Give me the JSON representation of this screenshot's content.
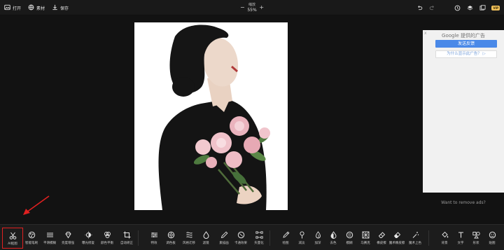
{
  "topbar": {
    "open_label": "打开",
    "assets_label": "素材",
    "save_label": "保存",
    "zoom_label": "缩放",
    "zoom_value": "55%",
    "zoom_minus": "−",
    "zoom_plus": "+",
    "vip_badge": "VIP"
  },
  "ad": {
    "close_symbol": "x",
    "google_text": "Google 提供的广告",
    "send_feedback": "发送反馈",
    "why_ad": "为什么显示此广告？ ▷",
    "remove_ads": "Want to remove ads?"
  },
  "tools": [
    {
      "label": "AI抠图",
      "icon": "scissors-icon",
      "selected": true
    },
    {
      "label": "智能笔刷",
      "icon": "smart-brush-icon"
    },
    {
      "label": "平滑模糊",
      "icon": "smooth-blur-icon"
    },
    {
      "label": "亮度增强",
      "icon": "diamond-icon"
    },
    {
      "label": "曝光修复",
      "icon": "exposure-icon"
    },
    {
      "label": "颜色平衡",
      "icon": "color-balance-icon"
    },
    {
      "label": "自动矫正",
      "icon": "crop-icon"
    },
    {
      "label": "特效",
      "icon": "sliders-icon"
    },
    {
      "label": "调色板",
      "icon": "palette-icon"
    },
    {
      "label": "风格迁移",
      "icon": "style-icon"
    },
    {
      "label": "滤镜",
      "icon": "drop-icon"
    },
    {
      "label": "素描画",
      "icon": "pencil-sketch-icon"
    },
    {
      "label": "卡通效果",
      "icon": "cartoon-icon"
    },
    {
      "label": "矢量化",
      "icon": "vector-icon"
    },
    {
      "label": "绘图",
      "icon": "pen-icon"
    },
    {
      "label": "减淡",
      "icon": "dodge-icon"
    },
    {
      "label": "加深",
      "icon": "burn-icon"
    },
    {
      "label": "去色",
      "icon": "desaturate-icon"
    },
    {
      "label": "模糊",
      "icon": "blur-icon"
    },
    {
      "label": "马赛克",
      "icon": "mosaic-icon"
    },
    {
      "label": "橡皮擦",
      "icon": "eraser-icon"
    },
    {
      "label": "魔术橡皮擦",
      "icon": "magic-eraser-icon"
    },
    {
      "label": "魔术上色",
      "icon": "magic-color-icon"
    },
    {
      "label": "背景",
      "icon": "fill-icon"
    },
    {
      "label": "文字",
      "icon": "text-icon"
    },
    {
      "label": "形状",
      "icon": "shapes-icon"
    },
    {
      "label": "贴图",
      "icon": "sticker-icon"
    }
  ]
}
